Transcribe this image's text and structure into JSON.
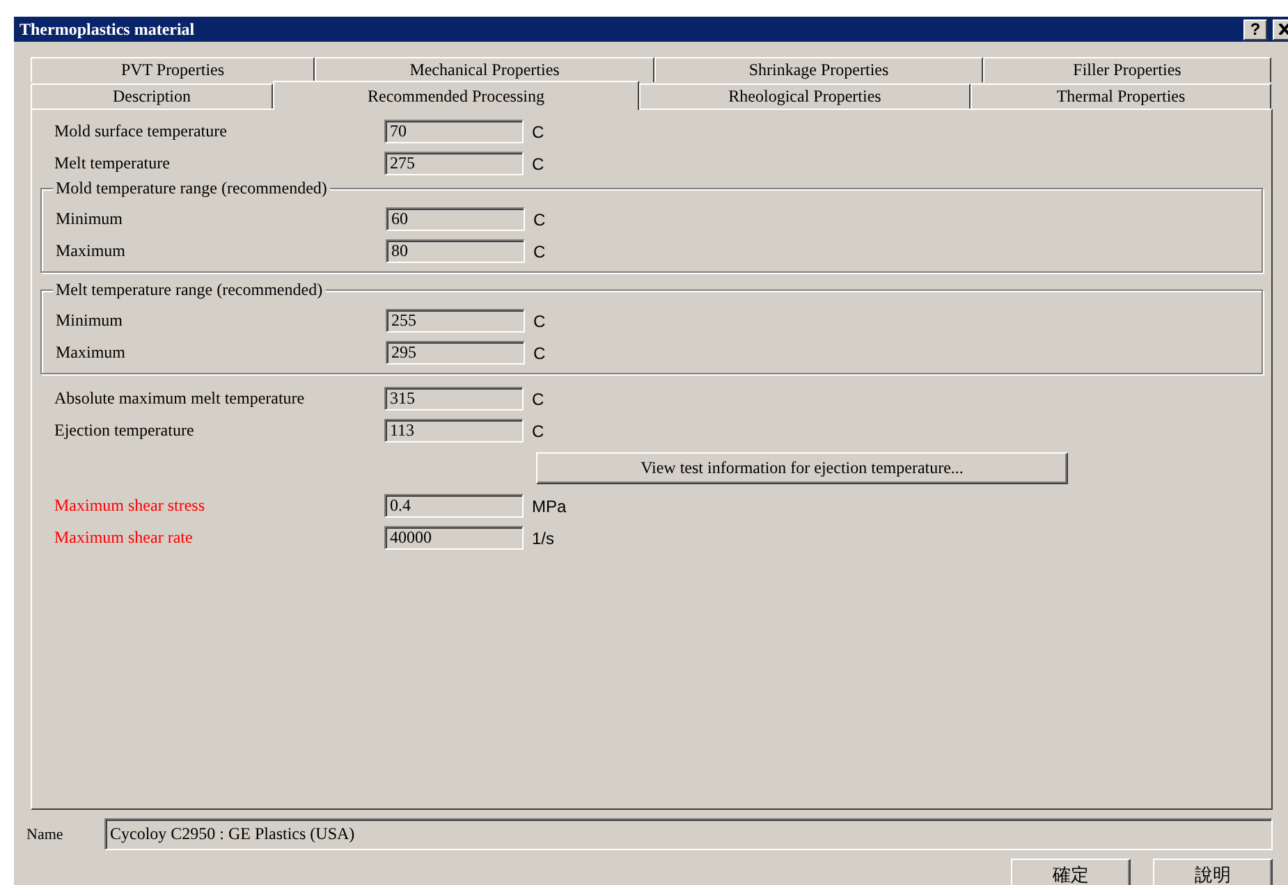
{
  "window": {
    "title": "Thermoplastics material",
    "help_button": "?"
  },
  "tab_rows": [
    [
      {
        "label": "PVT Properties",
        "selected": false
      },
      {
        "label": "Mechanical Properties",
        "selected": false
      },
      {
        "label": "Shrinkage Properties",
        "selected": false
      },
      {
        "label": "Filler Properties",
        "selected": false
      }
    ],
    [
      {
        "label": "Description",
        "selected": false
      },
      {
        "label": "Recommended Processing",
        "selected": true
      },
      {
        "label": "Rheological Properties",
        "selected": false
      },
      {
        "label": "Thermal Properties",
        "selected": false
      }
    ]
  ],
  "items": [
    {
      "kind": "field",
      "label": "Mold surface temperature",
      "value": "70",
      "unit": "C",
      "required": false
    },
    {
      "kind": "field",
      "label": "Melt temperature",
      "value": "275",
      "unit": "C",
      "required": false
    },
    {
      "kind": "group",
      "title": "Mold temperature range (recommended)",
      "fields": [
        {
          "label": "Minimum",
          "value": "60",
          "unit": "C",
          "required": false
        },
        {
          "label": "Maximum",
          "value": "80",
          "unit": "C",
          "required": false
        }
      ]
    },
    {
      "kind": "group",
      "title": "Melt temperature range (recommended)",
      "fields": [
        {
          "label": "Minimum",
          "value": "255",
          "unit": "C",
          "required": false
        },
        {
          "label": "Maximum",
          "value": "295",
          "unit": "C",
          "required": false
        }
      ]
    },
    {
      "kind": "field",
      "label": "Absolute maximum melt temperature",
      "value": "315",
      "unit": "C",
      "required": false
    },
    {
      "kind": "field",
      "label": "Ejection temperature",
      "value": "113",
      "unit": "C",
      "required": false
    },
    {
      "kind": "button",
      "label": "View test information for ejection temperature..."
    },
    {
      "kind": "field",
      "label": "Maximum shear stress",
      "value": "0.4",
      "unit": "MPa",
      "required": true
    },
    {
      "kind": "field",
      "label": "Maximum shear rate",
      "value": "40000",
      "unit": "1/s",
      "required": true
    }
  ],
  "name": {
    "label": "Name",
    "value": "Cycoloy C2950 : GE Plastics (USA)"
  },
  "buttons": [
    "確定",
    "說明"
  ]
}
